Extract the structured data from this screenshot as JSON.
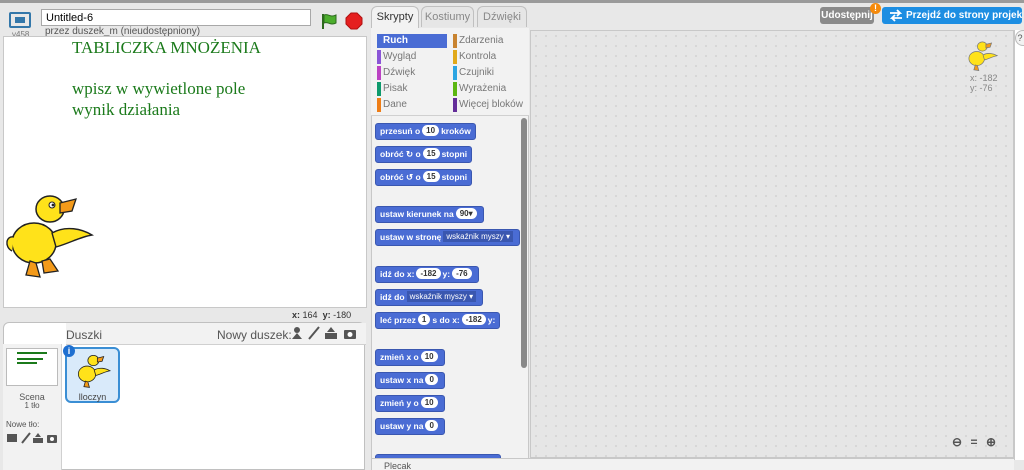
{
  "app": {
    "version": "v458",
    "project_title": "Untitled-6",
    "owner_line": "przez duszek_m (nieudostępniony)"
  },
  "stage": {
    "title": "TABLICZKA MNOŻENIA",
    "line1": "wpisz w wywietlone pole",
    "line2": "wynik działania",
    "coord_x_label": "x:",
    "coord_x": "164",
    "coord_y_label": "y:",
    "coord_y": "-180",
    "text_color": "#1b7a1b"
  },
  "sprites_pane": {
    "label": "Duszki",
    "new_sprite_label": "Nowy duszek:",
    "stage_label": "Scena",
    "backdrop_count": "1 tło",
    "new_backdrop_label": "Nowe tło:",
    "sprite_name": "lloczyn"
  },
  "tabs": [
    {
      "label": "Skrypty",
      "active": true
    },
    {
      "label": "Kostiumy",
      "active": false
    },
    {
      "label": "Dźwięki",
      "active": false
    }
  ],
  "categories_left": [
    {
      "label": "Ruch",
      "color": "#4a6cd4",
      "selected": true
    },
    {
      "label": "Wygląd",
      "color": "#8a55d7"
    },
    {
      "label": "Dźwięk",
      "color": "#bb42c3"
    },
    {
      "label": "Pisak",
      "color": "#0e9a6c"
    },
    {
      "label": "Dane",
      "color": "#ee7d16"
    }
  ],
  "categories_right": [
    {
      "label": "Zdarzenia",
      "color": "#c88330"
    },
    {
      "label": "Kontrola",
      "color": "#e1a91a"
    },
    {
      "label": "Czujniki",
      "color": "#2ca5e2"
    },
    {
      "label": "Wyrażenia",
      "color": "#5cb712"
    },
    {
      "label": "Więcej bloków",
      "color": "#632d99"
    }
  ],
  "blocks": {
    "move": {
      "pre": "przesuń o",
      "val": "10",
      "post": "kroków"
    },
    "turn_right": {
      "pre": "obróć ↻ o",
      "val": "15",
      "post": "stopni"
    },
    "turn_left": {
      "pre": "obróć ↺ o",
      "val": "15",
      "post": "stopni"
    },
    "point_dir": {
      "pre": "ustaw kierunek na",
      "val": "90▾"
    },
    "point_towards": {
      "pre": "ustaw w stronę",
      "dd": "wskaźnik myszy ▾"
    },
    "goto_xy": {
      "pre": "idź do x:",
      "x": "-182",
      "y_label": "y:",
      "y": "-76"
    },
    "goto": {
      "pre": "idź do",
      "dd": "wskaźnik myszy ▾"
    },
    "glide": {
      "pre": "leć przez",
      "val": "1",
      "mid": "s do x:",
      "x": "-182",
      "y_label": "y:"
    },
    "change_x": {
      "pre": "zmień x o",
      "val": "10"
    },
    "set_x": {
      "pre": "ustaw x na",
      "val": "0"
    },
    "change_y": {
      "pre": "zmień y o",
      "val": "10"
    },
    "set_y": {
      "pre": "ustaw y na",
      "val": "0"
    }
  },
  "scripts_area": {
    "sprite_x_label": "x:",
    "sprite_x": "-182",
    "sprite_y_label": "y:",
    "sprite_y": "-76",
    "bottom_label": "Plecak"
  },
  "header_right": {
    "share_label": "Udostępnij",
    "share_badge": "!",
    "goto_project_label": "Przejdź do strony projektu",
    "help": "?"
  },
  "icons": [
    "fullscreen-icon",
    "green-flag-icon",
    "stop-icon",
    "paint-icon",
    "upload-icon",
    "camera-icon",
    "sprite-library-icon",
    "zoom-out-icon",
    "zoom-reset-icon",
    "zoom-in-icon",
    "info-icon"
  ]
}
